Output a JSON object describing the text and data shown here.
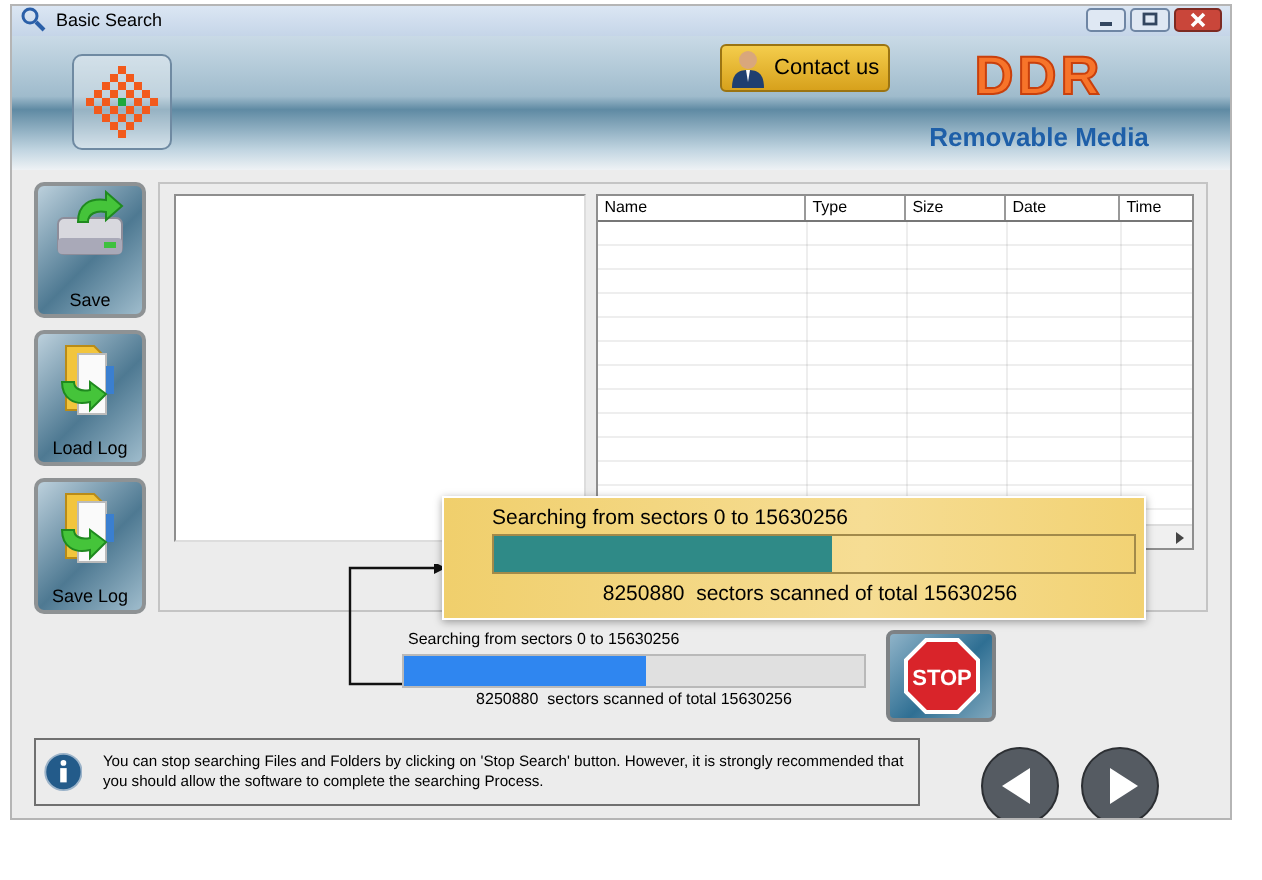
{
  "window": {
    "title": "Basic Search"
  },
  "header": {
    "contact_button": "Contact us",
    "brand": "DDR",
    "product": "Removable Media"
  },
  "side_buttons": [
    {
      "label": "Save",
      "kind": "drive"
    },
    {
      "label": "Load Log",
      "kind": "folder"
    },
    {
      "label": "Save Log",
      "kind": "folder"
    }
  ],
  "table": {
    "columns": [
      "Name",
      "Type",
      "Size",
      "Date",
      "Time"
    ]
  },
  "popup": {
    "range": "Searching from sectors 0 to 15630256",
    "level": 0.528,
    "scanned": "8250880  sectors scanned of total 15630256"
  },
  "progress": {
    "range": "Searching from sectors 0 to 15630256",
    "level": 0.528,
    "scanned": "8250880  sectors scanned of total 15630256"
  },
  "stop_button": "STOP",
  "info": "You can stop searching Files and Folders by clicking on 'Stop Search' button. However, it is strongly recommended that you should allow the software to complete the searching Process."
}
